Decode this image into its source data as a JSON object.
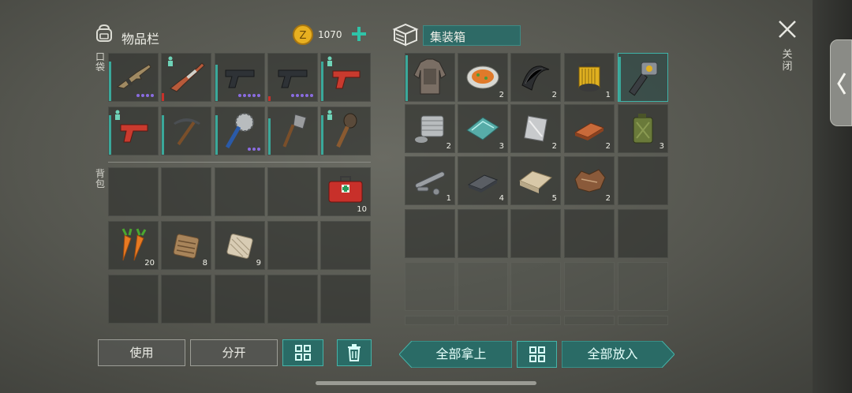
{
  "inventory": {
    "title": "物品栏",
    "coins": "1070",
    "pocket_label": "口袋",
    "backpack_label": "背包",
    "pocket": [
      {
        "name": "rifle",
        "count": ""
      },
      {
        "name": "shotgun",
        "count": ""
      },
      {
        "name": "pistol",
        "count": ""
      },
      {
        "name": "pistol",
        "count": ""
      },
      {
        "name": "flare-gun",
        "count": ""
      },
      {
        "name": "flare-gun",
        "count": ""
      },
      {
        "name": "pickaxe",
        "count": ""
      },
      {
        "name": "saw-mace",
        "count": ""
      },
      {
        "name": "shovel",
        "count": ""
      },
      {
        "name": "spiked-club",
        "count": ""
      }
    ],
    "backpack": [
      {
        "name": "empty",
        "count": ""
      },
      {
        "name": "empty",
        "count": ""
      },
      {
        "name": "empty",
        "count": ""
      },
      {
        "name": "empty",
        "count": ""
      },
      {
        "name": "first-aid-kit",
        "count": "10"
      },
      {
        "name": "carrots",
        "count": "20"
      },
      {
        "name": "hay",
        "count": "8"
      },
      {
        "name": "fiber",
        "count": "9"
      }
    ]
  },
  "container": {
    "title": "集装箱",
    "items": [
      {
        "name": "armor-jacket",
        "count": ""
      },
      {
        "name": "vegetable-stew",
        "count": "2"
      },
      {
        "name": "rubber-sheet",
        "count": "2"
      },
      {
        "name": "oil-filter",
        "count": "1"
      },
      {
        "name": "chainsaw-part",
        "count": ""
      },
      {
        "name": "engine-cylinder",
        "count": "2"
      },
      {
        "name": "glass-sheet",
        "count": "3"
      },
      {
        "name": "metal-plate",
        "count": "2"
      },
      {
        "name": "copper-ingot",
        "count": "2"
      },
      {
        "name": "jerry-can",
        "count": "3"
      },
      {
        "name": "pipe-parts",
        "count": "1"
      },
      {
        "name": "iron-ingot",
        "count": "4"
      },
      {
        "name": "cloth",
        "count": "5"
      },
      {
        "name": "leather",
        "count": "2"
      }
    ]
  },
  "buttons": {
    "use": "使用",
    "split": "分开",
    "take_all": "全部拿上",
    "put_all": "全部放入"
  },
  "close_label": "关闭",
  "colors": {
    "accent": "#2a6b66",
    "accent_border": "#45b3a8",
    "coin": "#e8b020",
    "plus": "#2fc3a8"
  }
}
